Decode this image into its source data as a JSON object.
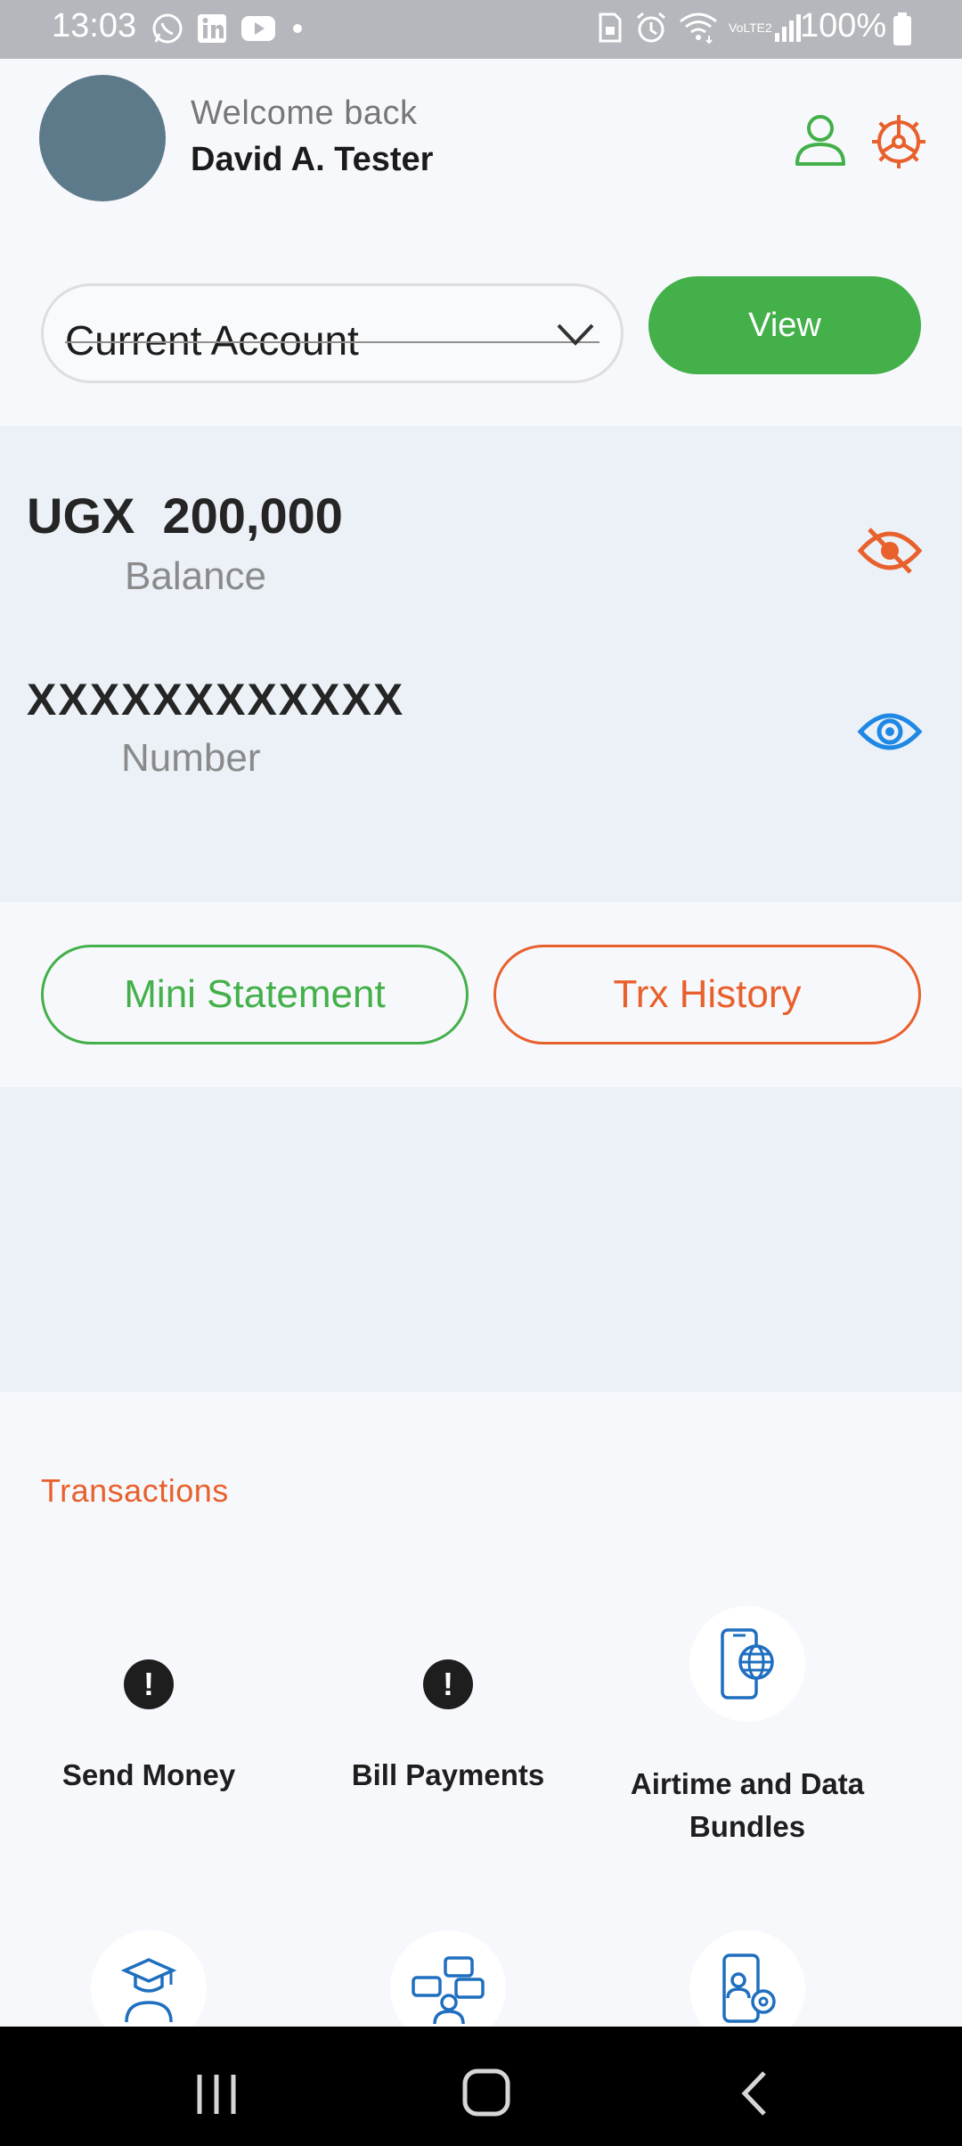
{
  "status_bar": {
    "time": "13:03",
    "battery_text": "100%",
    "network_label": "VoLTE2",
    "icons": [
      "whatsapp-icon",
      "linkedin-icon",
      "youtube-icon",
      "dot-icon",
      "sim-lock-icon",
      "alarm-icon",
      "wifi-icon",
      "signal-icon",
      "battery-icon"
    ]
  },
  "header": {
    "welcome": "Welcome back",
    "user_name": "David A. Tester",
    "profile_icon": "person-icon",
    "settings_icon": "settings-gear-icon"
  },
  "account": {
    "selected": "Current Account",
    "view_label": "View"
  },
  "balance": {
    "amount": "UGX  200,000",
    "label": "Balance",
    "number_masked": "XXXXXXXXXXXX",
    "number_label": "Number"
  },
  "actions": {
    "mini_statement": "Mini Statement",
    "trx_history": "Trx History"
  },
  "transactions": {
    "title": "Transactions",
    "items": [
      {
        "label": "Send Money",
        "icon": "alert-icon"
      },
      {
        "label": "Bill Payments",
        "icon": "alert-icon"
      },
      {
        "label_line1": "Airtime and Data",
        "label_line2": "Bundles",
        "icon": "phone-globe-icon"
      }
    ],
    "partial_items": [
      "graduate-icon",
      "chat-people-icon",
      "phone-settings-icon"
    ]
  },
  "colors": {
    "green": "#43b04a",
    "orange": "#e8602c",
    "blue": "#1f88e5",
    "panel": "#ebf1f7"
  }
}
